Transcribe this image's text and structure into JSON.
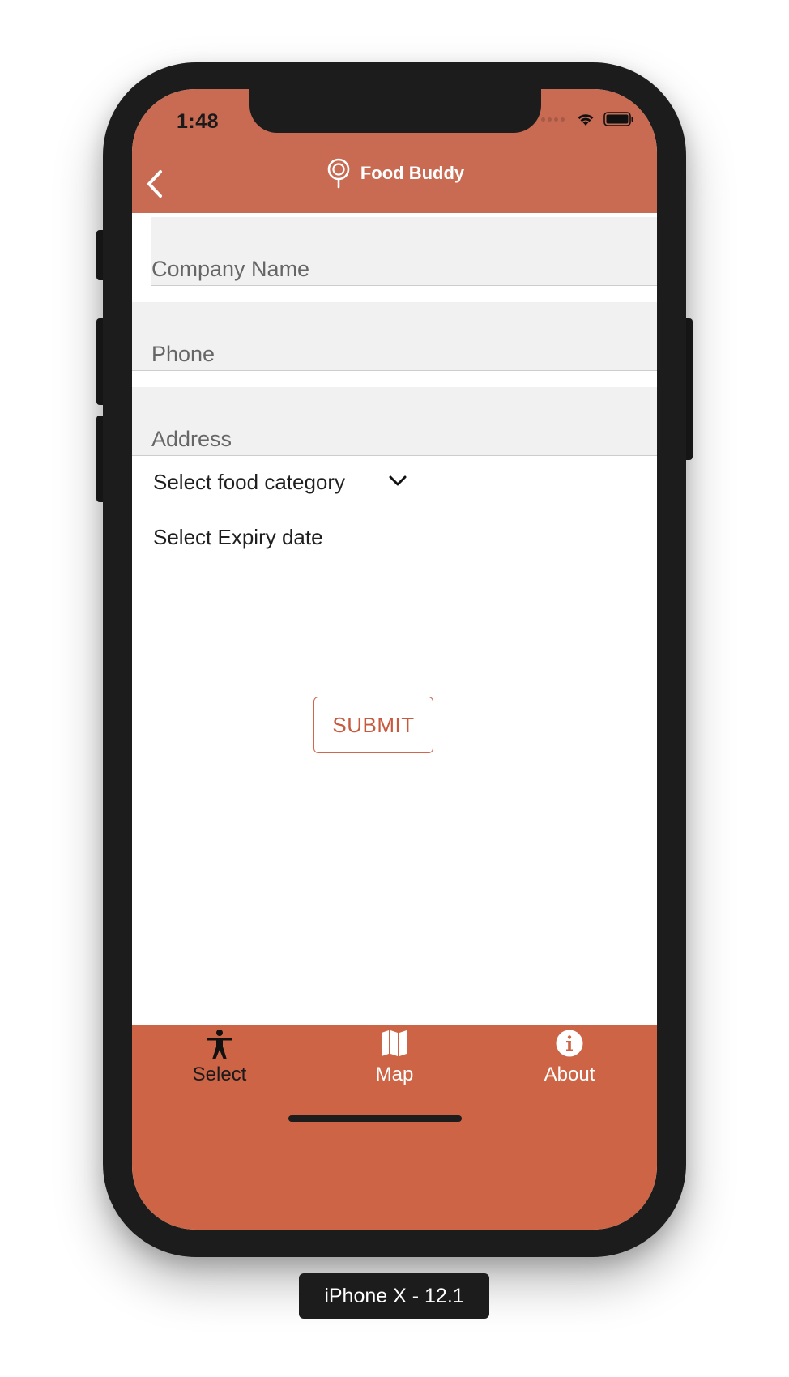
{
  "status_bar": {
    "time": "1:48"
  },
  "nav": {
    "brand_title": "Food Buddy",
    "back_icon": "chevron-left-icon",
    "logo_icon": "location-pin-icon"
  },
  "form": {
    "company_name_placeholder": "Company Name",
    "phone_placeholder": "Phone",
    "address_placeholder": "Address",
    "category_label": "Select food category",
    "expiry_label": "Select Expiry date",
    "submit_label": "SUBMIT"
  },
  "tabs": [
    {
      "label": "Select",
      "icon": "accessibility-person-icon",
      "active": true
    },
    {
      "label": "Map",
      "icon": "map-icon",
      "active": false
    },
    {
      "label": "About",
      "icon": "info-icon",
      "active": false
    }
  ],
  "simulator_label": "iPhone X - 12.1",
  "colors": {
    "header": "#c96a53",
    "tabbar": "#cd6446",
    "accent": "#c75a3e",
    "field_bg": "#f1f1f2"
  }
}
